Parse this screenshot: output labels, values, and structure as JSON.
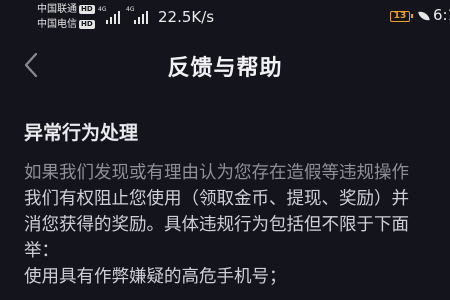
{
  "status_bar": {
    "carrier1": "中国联通",
    "carrier2": "中国电信",
    "hd_label": "HD",
    "net_tag": "4G",
    "net_speed": "22.5K/s",
    "battery_level": "13",
    "time": "6:1"
  },
  "nav": {
    "title": "反馈与帮助",
    "back_icon": "chevron-left-icon"
  },
  "content": {
    "section_title": "异常行为处理",
    "lines": [
      "如果我们发现或有理由认为您存在造假等违规操作",
      "我们有权阻止您使用（领取金币、提现、奖励）并",
      "消您获得的奖励。具体违规行为包括但不限于下面",
      "举：",
      "使用具有作弊嫌疑的高危手机号；"
    ]
  },
  "colors": {
    "background": "#14141c",
    "battery_accent": "#f0a020"
  }
}
